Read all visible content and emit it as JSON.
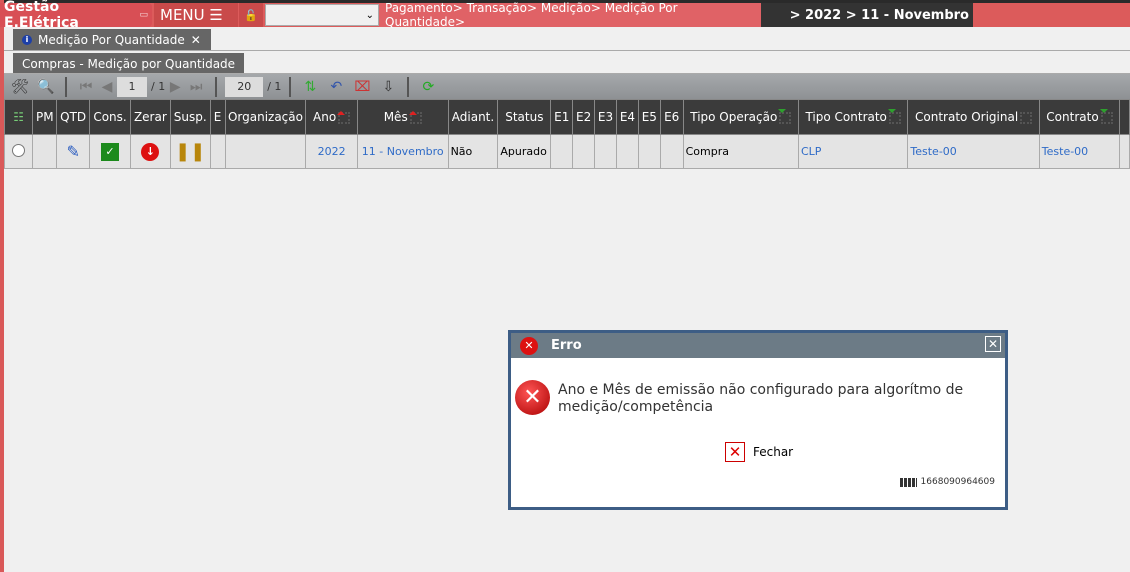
{
  "topbar": {
    "brand": "Gestão E.Elétrica",
    "menu": "MENU",
    "breadcrumb": "Pagamento> Transação> Medição> Medição Por Quantidade>",
    "context": "> 2022 > 11 - Novembro"
  },
  "tabs": {
    "main": "Medição Por Quantidade",
    "sub": "Compras - Medição por Quantidade"
  },
  "toolbar": {
    "page": "1",
    "page_total": "/ 1",
    "page_size": "20",
    "size_total": "/ 1"
  },
  "table": {
    "headers": [
      "PM",
      "QTD",
      "Cons.",
      "Zerar",
      "Susp.",
      "E",
      "Organização",
      "Ano",
      "Mês",
      "Adiant.",
      "Status",
      "E1",
      "E2",
      "E3",
      "E4",
      "E5",
      "E6",
      "Tipo Operação",
      "Tipo Contrato",
      "Contrato Original",
      "Contrato"
    ],
    "row": {
      "ano": "2022",
      "mes": "11 - Novembro",
      "adiant": "Não",
      "status": "Apurado",
      "tipo_operacao": "Compra",
      "tipo_contrato": "CLP",
      "contrato_original": "Teste-00",
      "contrato": "Teste-00"
    }
  },
  "dialog": {
    "title": "Erro",
    "message": "Ano e Mês de emissão não configurado para algorítmo de medição/competência",
    "close_label": "Fechar",
    "code": "1668090964609"
  },
  "colors": {
    "brand": "#dc5b5b",
    "header": "#3b3b3b",
    "dialog_border": "#3d5d85"
  }
}
